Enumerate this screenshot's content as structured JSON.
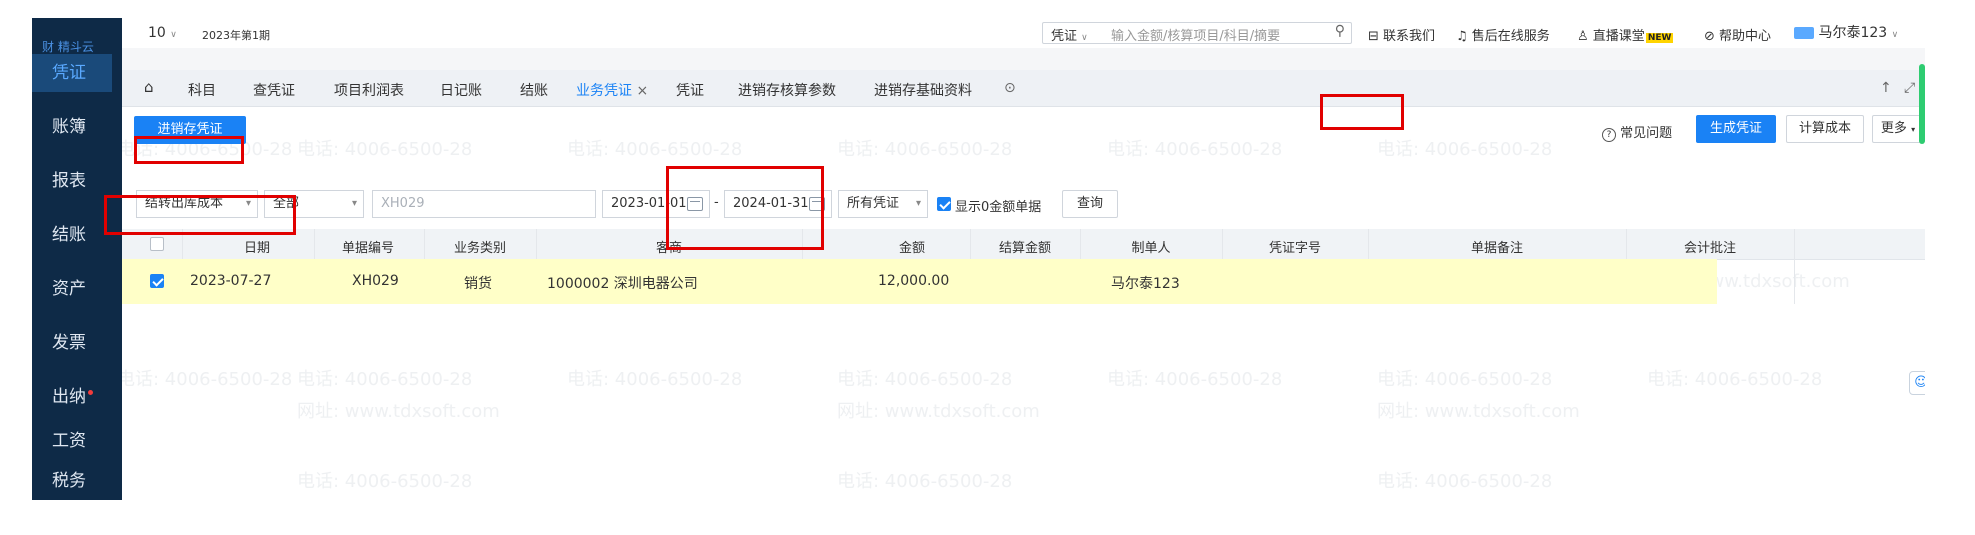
{
  "sidebar": {
    "logo": "财 精斗云",
    "items": [
      "凭证",
      "账簿",
      "报表",
      "结账",
      "资产",
      "发票",
      "出纳",
      "工资",
      "税务"
    ]
  },
  "topbar": {
    "period_num": "10",
    "period_label": "2023年第1期",
    "search_type": "凭证",
    "search_placeholder": "输入金额/核算项目/科目/摘要",
    "contact": "联系我们",
    "service": "售后在线服务",
    "live": "直播课堂",
    "new_badge": "NEW",
    "help": "帮助中心",
    "user": "马尔泰123"
  },
  "tabs": [
    "科目",
    "查凭证",
    "项目利润表",
    "日记账",
    "结账",
    "业务凭证",
    "凭证",
    "进销存核算参数",
    "进销存基础资料"
  ],
  "toolbar": {
    "inventory_voucher": "进销存凭证",
    "faq": "常见问题",
    "generate": "生成凭证",
    "calc_cost": "计算成本",
    "more": "更多"
  },
  "filters": {
    "type": "结转出库成本",
    "scope": "全部",
    "doc_no": "XH029",
    "date_from": "2023-01-01",
    "date_to": "2024-01-31",
    "voucher_status": "所有凭证",
    "show_zero": "显示0金额单据",
    "query": "查询"
  },
  "table": {
    "headers": [
      "日期",
      "单据编号",
      "业务类别",
      "客商",
      "金额",
      "结算金额",
      "制单人",
      "凭证字号",
      "单据备注",
      "会计批注"
    ],
    "rows": [
      {
        "date": "2023-07-27",
        "doc_no": "XH029",
        "biz_type": "销货",
        "partner": "1000002 深圳电器公司",
        "amount": "12,000.00",
        "settled": "",
        "creator": "马尔泰123",
        "voucher_no": "",
        "remark": "",
        "note": ""
      }
    ]
  },
  "watermark": {
    "phone": "电话: 4006-6500-28",
    "site": "网址: www.tdxsoft.com"
  },
  "colors": {
    "accent": "#1a82f5",
    "highlight_row": "#ffffc8",
    "annotation": "#e10000",
    "sidebar": "#0e2a47"
  }
}
